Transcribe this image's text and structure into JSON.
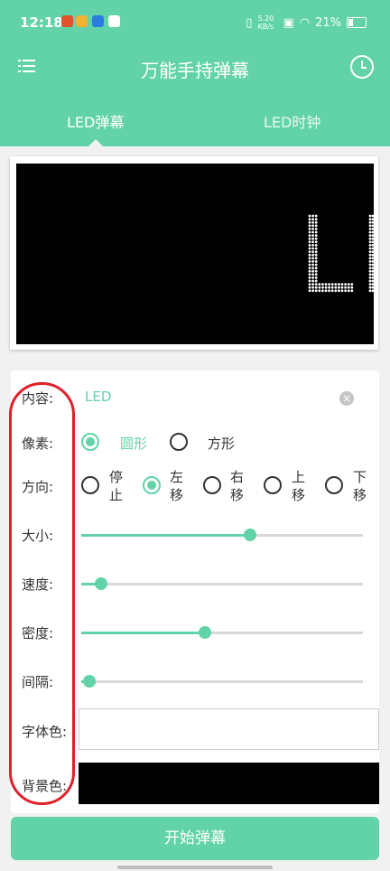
{
  "status_bar": {
    "time": "12:18",
    "net_speed": "5.20 KB/s",
    "battery": "21%"
  },
  "app_bar": {
    "title": "万能手持弹幕",
    "tabs": [
      {
        "label": "LED弹幕",
        "active": true
      },
      {
        "label": "LED时钟",
        "active": false
      }
    ]
  },
  "preview": {
    "text": "L",
    "dot_color": "#ffffff",
    "background": "#000000"
  },
  "settings": {
    "content": {
      "label": "内容:",
      "value": "LED"
    },
    "pixel": {
      "label": "像素:",
      "options": [
        {
          "label": "圆形",
          "selected": true
        },
        {
          "label": "方形",
          "selected": false
        }
      ]
    },
    "direction": {
      "label": "方向:",
      "options": [
        {
          "label": "停止",
          "selected": false
        },
        {
          "label": "左移",
          "selected": true
        },
        {
          "label": "右移",
          "selected": false
        },
        {
          "label": "上移",
          "selected": false
        },
        {
          "label": "下移",
          "selected": false
        }
      ]
    },
    "size": {
      "label": "大小:",
      "value": 0.6
    },
    "speed": {
      "label": "速度:",
      "value": 0.07
    },
    "density": {
      "label": "密度:",
      "value": 0.44
    },
    "interval": {
      "label": "间隔:",
      "value": 0.03
    },
    "font_color": {
      "label": "字体色:",
      "color": "#ffffff"
    },
    "bg_color": {
      "label": "背景色:",
      "color": "#000000"
    }
  },
  "start_button": {
    "label": "开始弹幕"
  },
  "colors": {
    "accent": "#62d3a8",
    "highlight": "#e0202a"
  }
}
